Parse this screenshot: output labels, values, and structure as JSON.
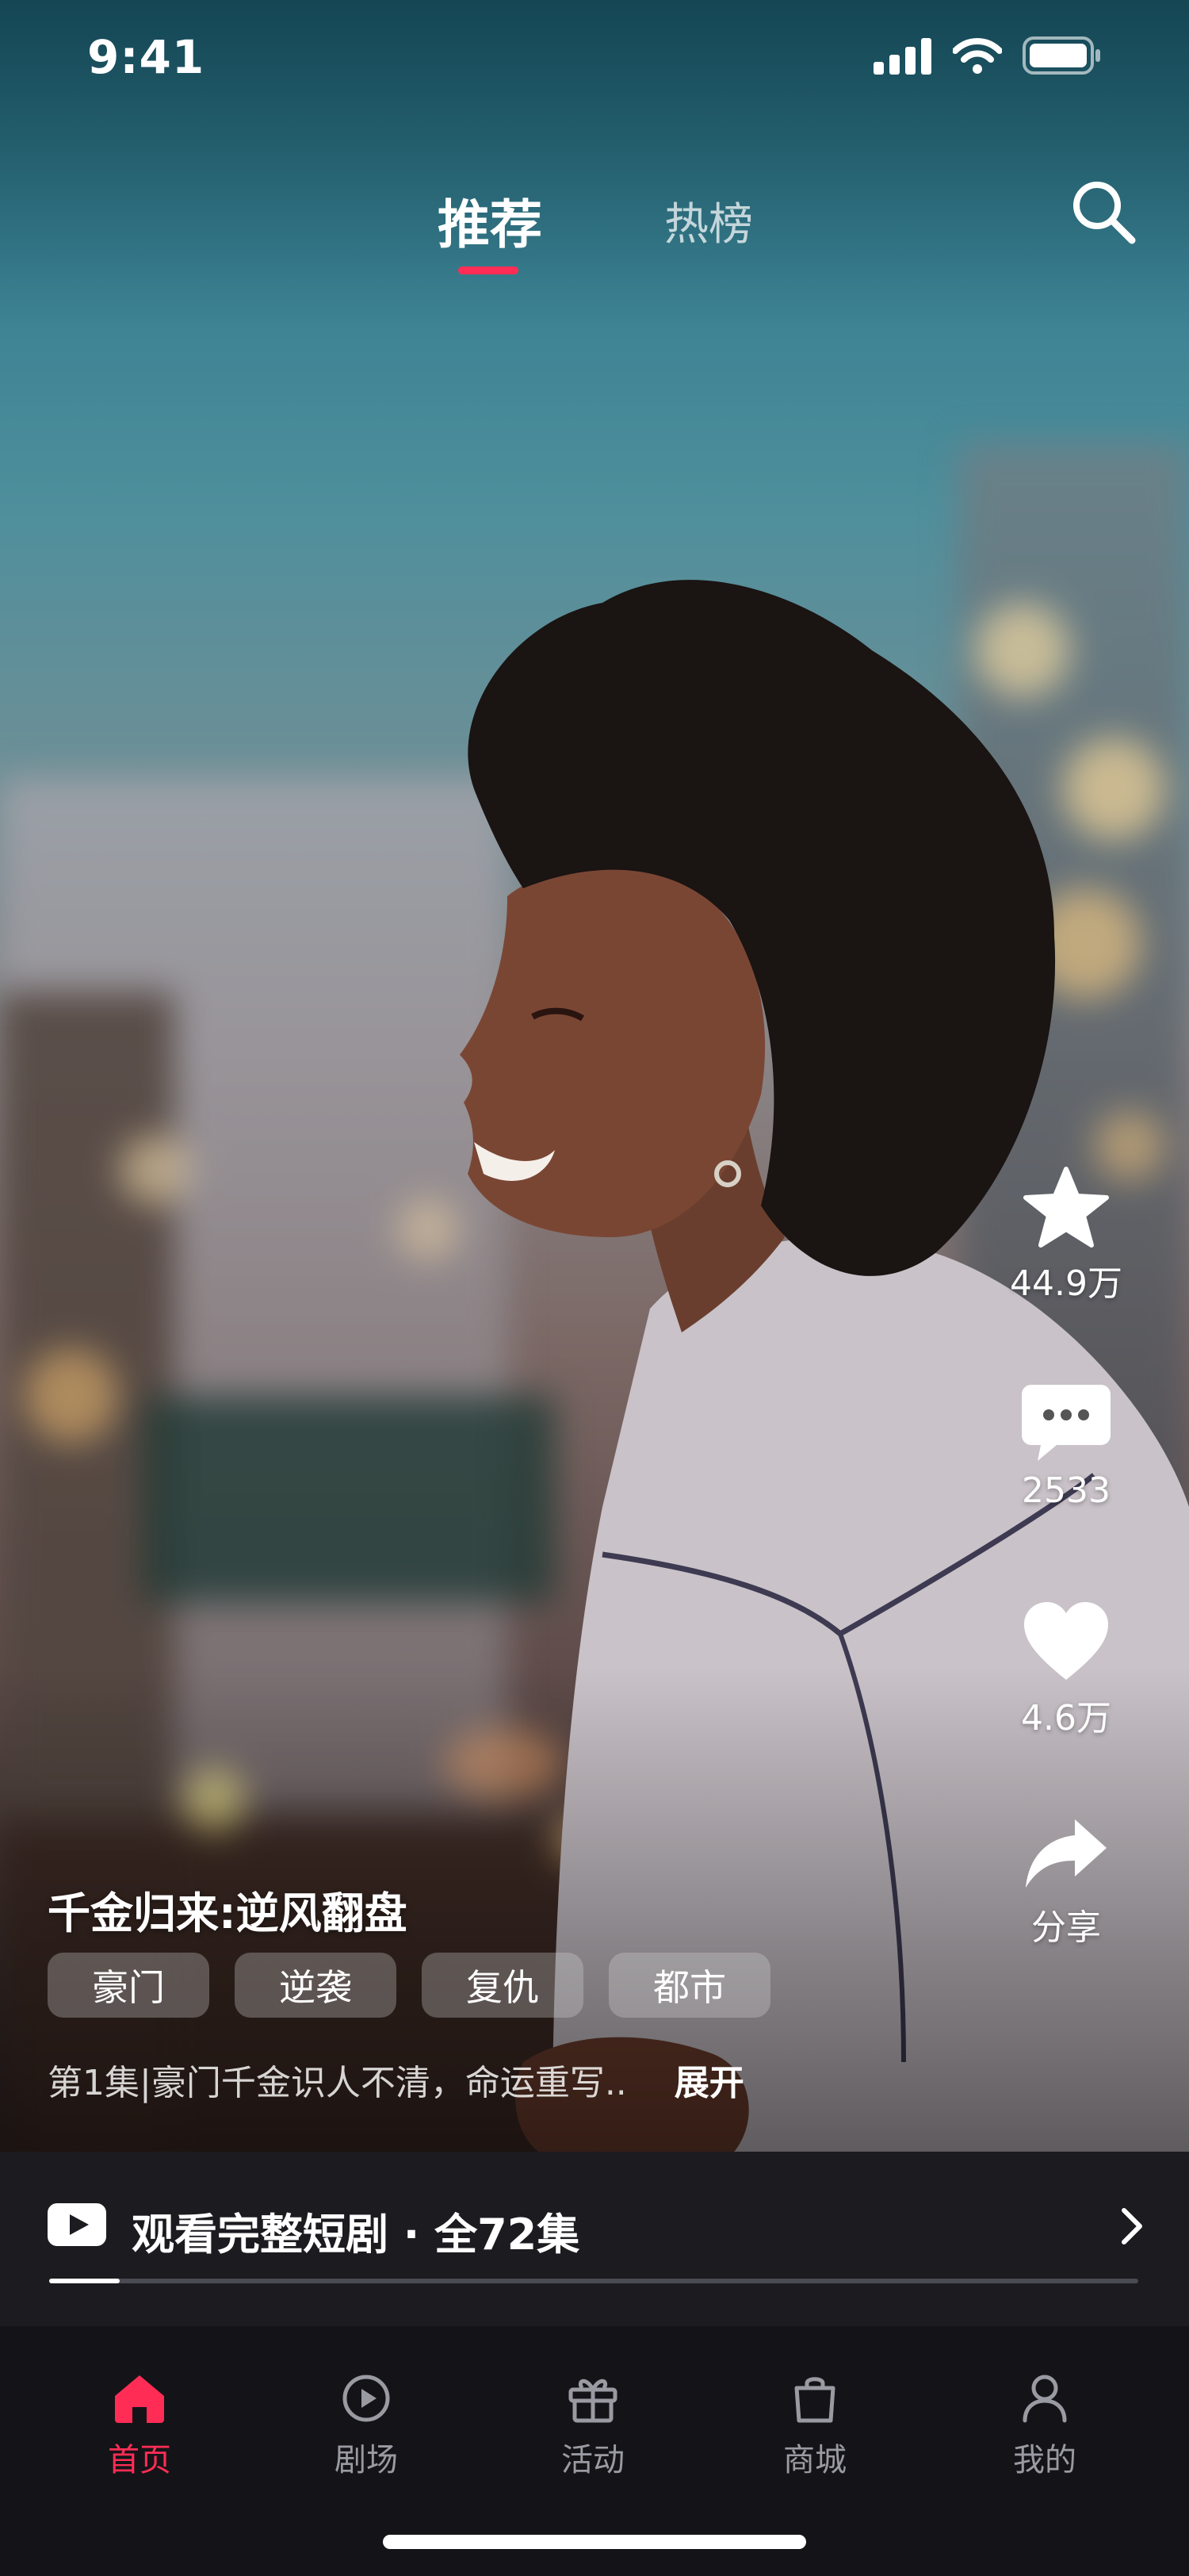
{
  "status_bar": {
    "time": "9:41"
  },
  "header": {
    "tabs": [
      {
        "label": "推荐",
        "active": true
      },
      {
        "label": "热榜",
        "active": false
      }
    ]
  },
  "actions": {
    "favorite_count": "44.9万",
    "comment_count": "2533",
    "like_count": "4.6万",
    "share_label": "分享"
  },
  "drama": {
    "title": "千金归来:逆风翻盘",
    "tags": [
      "豪门",
      "逆袭",
      "复仇",
      "都市"
    ],
    "description": "第1集|豪门千金识人不清，命运重写..",
    "expand_label": "展开"
  },
  "watch_full": {
    "label": "观看完整短剧 · 全72集",
    "progress": 0.065
  },
  "bottom_nav": [
    {
      "label": "首页",
      "icon": "home-icon",
      "active": true
    },
    {
      "label": "剧场",
      "icon": "play-circle-icon",
      "active": false
    },
    {
      "label": "活动",
      "icon": "gift-icon",
      "active": false
    },
    {
      "label": "商城",
      "icon": "shopping-bag-icon",
      "active": false
    },
    {
      "label": "我的",
      "icon": "user-icon",
      "active": false
    }
  ],
  "colors": {
    "accent": "#ff2d55",
    "nav_background": "#141418",
    "inactive_nav": "#9a9aa2"
  }
}
